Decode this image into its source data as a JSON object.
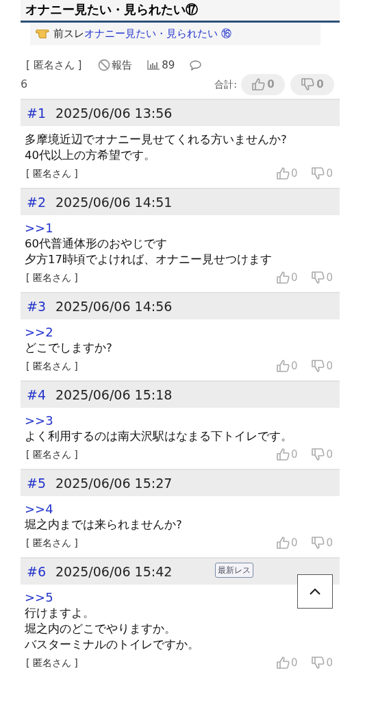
{
  "thread_title": "オナニー見たい・見られたい⑰",
  "previous_thread": {
    "label": "前スレ",
    "link": "オナニー見たい・見られたい ⑯"
  },
  "thread_meta": {
    "author": "[ 匿名さん ]",
    "report": "報告",
    "views": "89",
    "comments": "6",
    "total_label": "合計:",
    "likes": "0",
    "dislikes": "0"
  },
  "posts": [
    {
      "number": "#1",
      "date": "2025/06/06 13:56",
      "body": [
        "多摩境近辺でオナニー見せてくれる方いませんか?",
        "40代以上の方希望です。"
      ],
      "author": "[ 匿名さん ]",
      "likes": "0",
      "dislikes": "0"
    },
    {
      "number": "#2",
      "date": "2025/06/06 14:51",
      "reply_to": ">>1",
      "body": [
        "60代普通体形のおやじです",
        "夕方17時頃でよければ、オナニー見せつけます"
      ],
      "author": "[ 匿名さん ]",
      "likes": "0",
      "dislikes": "0"
    },
    {
      "number": "#3",
      "date": "2025/06/06 14:56",
      "reply_to": ">>2",
      "body": [
        "どこでしますか?"
      ],
      "author": "[ 匿名さん ]",
      "likes": "0",
      "dislikes": "0"
    },
    {
      "number": "#4",
      "date": "2025/06/06 15:18",
      "reply_to": ">>3",
      "body": [
        "よく利用するのは南大沢駅はなまる下トイレです。"
      ],
      "author": "[ 匿名さん ]",
      "likes": "0",
      "dislikes": "0"
    },
    {
      "number": "#5",
      "date": "2025/06/06 15:27",
      "reply_to": ">>4",
      "body": [
        "堀之内までは来られませんか?"
      ],
      "author": "[ 匿名さん ]",
      "likes": "0",
      "dislikes": "0"
    },
    {
      "number": "#6",
      "date": "2025/06/06 15:42",
      "latest_label": "最新レス",
      "reply_to": ">>5",
      "body": [
        "行けますよ。",
        "堀之内のどこでやりますか。",
        "バスターミナルのトイレですか。"
      ],
      "author": "[ 匿名さん ]",
      "likes": "0",
      "dislikes": "0"
    }
  ]
}
